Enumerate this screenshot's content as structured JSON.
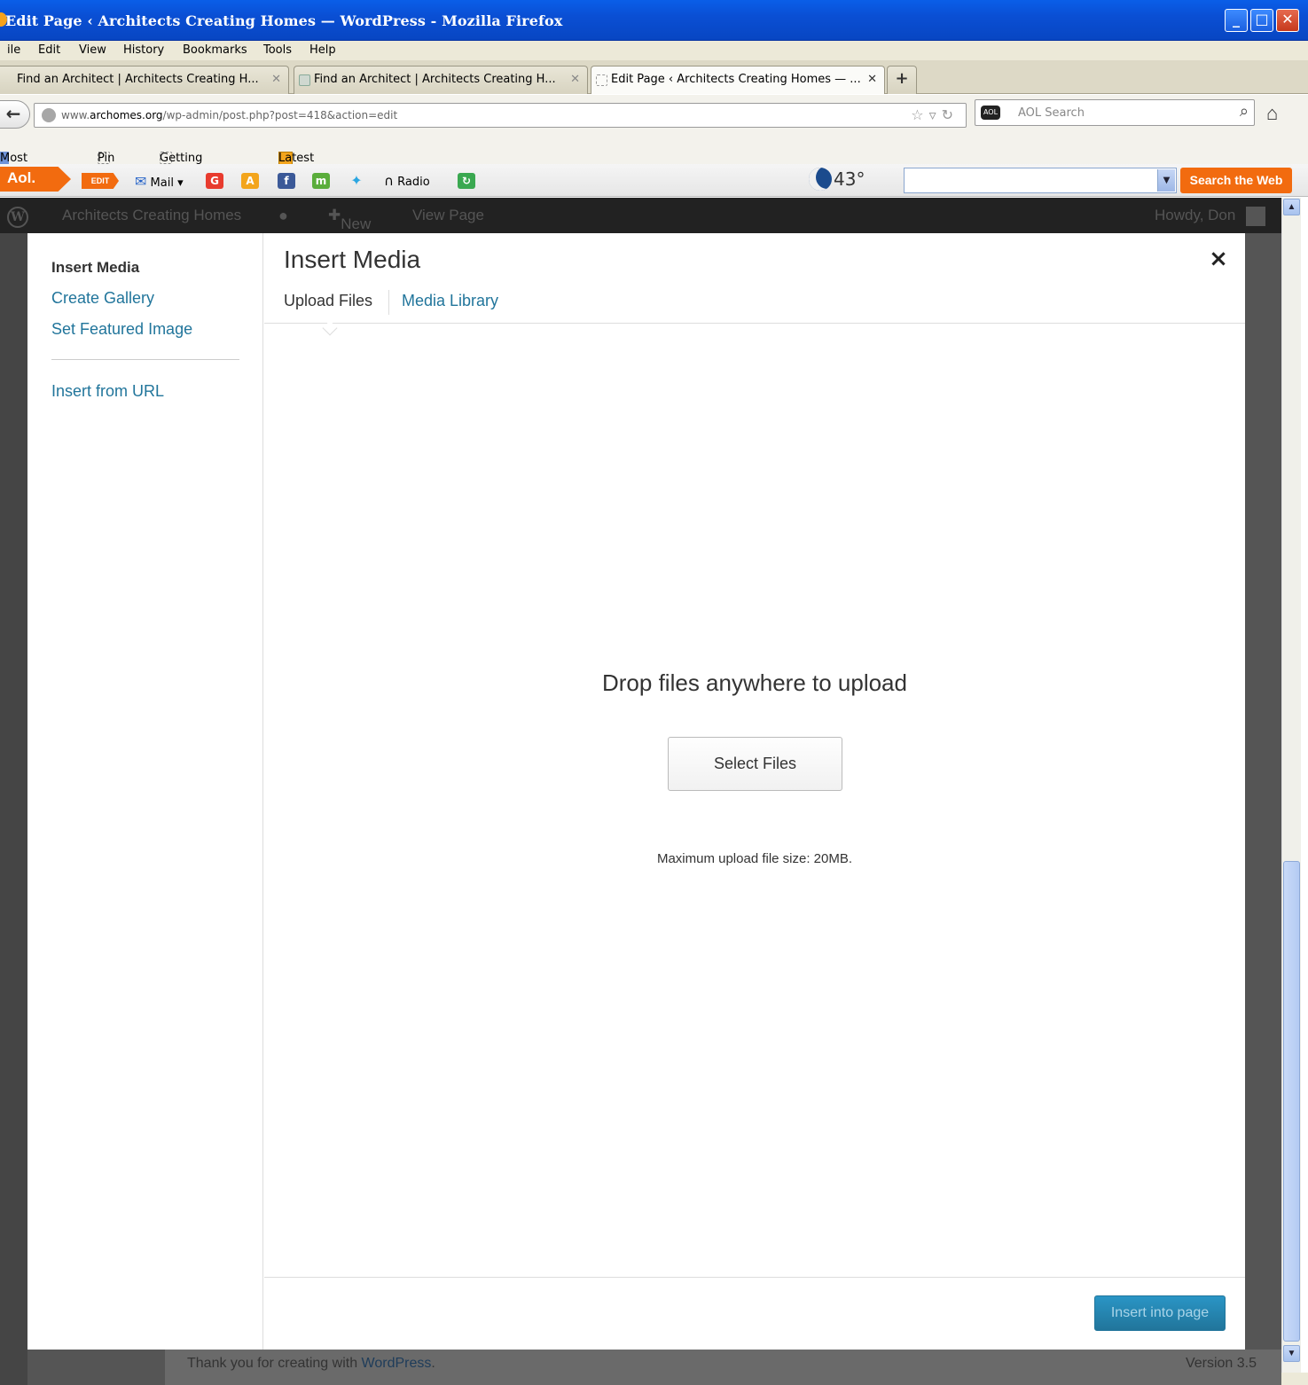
{
  "window": {
    "title": "Edit Page ‹ Architects Creating Homes — WordPress - Mozilla Firefox",
    "controls": [
      "_",
      "□",
      "✕"
    ]
  },
  "menubar": [
    "ile",
    "Edit",
    "View",
    "History",
    "Bookmarks",
    "Tools",
    "Help"
  ],
  "tabs": [
    {
      "label": "Find an Architect | Architects Creating H...",
      "active": false
    },
    {
      "label": "Find an Architect | Architects Creating H...",
      "active": false
    },
    {
      "label": "Edit Page ‹ Architects Creating Homes — ...",
      "active": true
    }
  ],
  "newtab_label": "+",
  "navbar": {
    "url_prefix": "www.",
    "url_domain": "archomes.org",
    "url_path": "/wp-admin/post.php?post=418&action=edit",
    "search_placeholder": "AOL Search"
  },
  "bookmarks": [
    "Most Visited",
    "Pin It",
    "Getting Started",
    "Latest Headlines"
  ],
  "aol_toolbar": {
    "logo": "Aol.",
    "edit": "EDIT",
    "mail": "Mail",
    "radio": "Radio",
    "temperature": "43°",
    "search_button": "Search the Web",
    "colors": {
      "orange": "#f26b0f"
    }
  },
  "wp_adminbar": {
    "site_name": "Architects Creating Homes",
    "new_label": "New",
    "view_page": "View Page",
    "howdy": "Howdy, Don"
  },
  "wp_footer": {
    "thanks_prefix": "Thank you for creating with ",
    "thanks_link": "WordPress",
    "thanks_suffix": ".",
    "version": "Version 3.5"
  },
  "modal": {
    "sidebar": {
      "title": "Insert Media",
      "items": [
        "Create Gallery",
        "Set Featured Image",
        "Insert from URL"
      ]
    },
    "title": "Insert Media",
    "close": "×",
    "router": {
      "upload": "Upload Files",
      "library": "Media Library"
    },
    "uploader": {
      "drop_text": "Drop files anywhere to upload",
      "select_button": "Select Files",
      "max_size": "Maximum upload file size: 20MB."
    },
    "insert_button": "Insert into page",
    "colors": {
      "link": "#21759b",
      "primary": "#21759b"
    }
  }
}
